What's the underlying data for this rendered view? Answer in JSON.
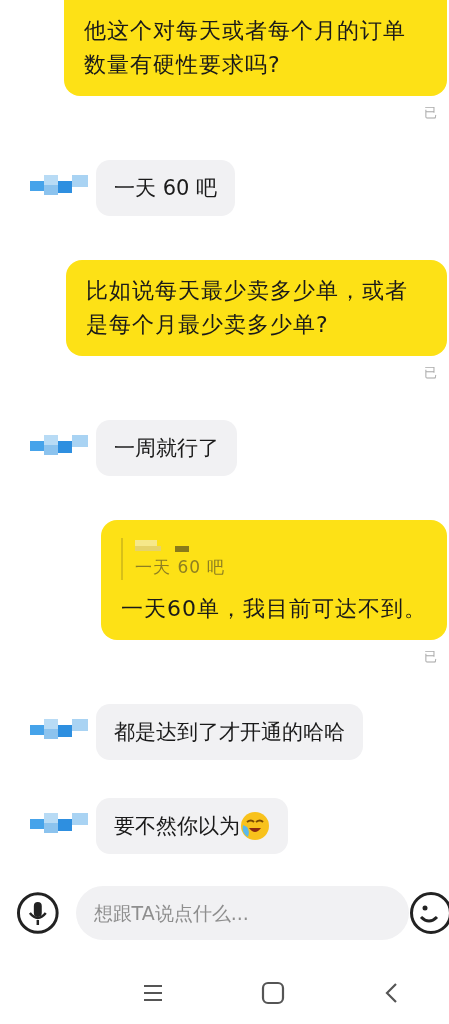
{
  "messages": [
    {
      "kind": "sent",
      "text": "他这个对每天或者每个月的订单数量有硬性要求吗?",
      "read_label": "已"
    },
    {
      "kind": "received",
      "text": "一天 60 吧"
    },
    {
      "kind": "sent",
      "text": "比如说每天最少卖多少单，或者是每个月最少卖多少单?",
      "read_label": "已"
    },
    {
      "kind": "received",
      "text": "一周就行了"
    },
    {
      "kind": "sent",
      "quote": "一天 60 吧",
      "text": "一天60单，我目前可达不到。",
      "read_label": "已"
    },
    {
      "kind": "received",
      "text": "都是达到了才开通的哈哈"
    },
    {
      "kind": "received",
      "text": "要不然你以为",
      "trailing_emoji": true
    }
  ],
  "composer": {
    "placeholder": "想跟TA说点什么..."
  }
}
